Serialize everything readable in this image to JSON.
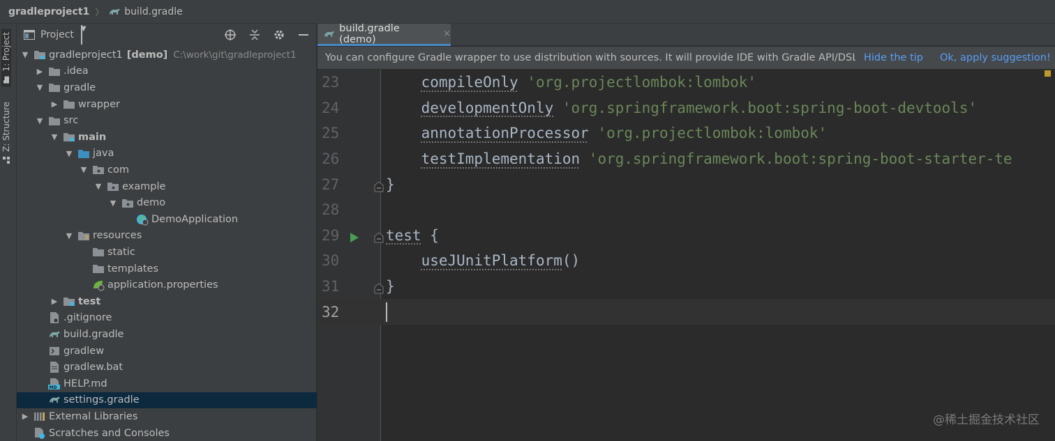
{
  "navbar": {
    "project": "gradleproject1",
    "separator": "〉",
    "file": "build.gradle"
  },
  "strip": {
    "project_tool": "1: Project",
    "structure_tool": "Z: Structure"
  },
  "panel": {
    "title": "Project",
    "tree": [
      {
        "label": "gradleproject1",
        "suffix": "[demo]",
        "path": "C:\\work\\git\\gradleproject1",
        "depth": 0,
        "arrow": "open",
        "icon": "module-folder-icon"
      },
      {
        "label": ".idea",
        "depth": 1,
        "arrow": "closed",
        "icon": "folder-icon"
      },
      {
        "label": "gradle",
        "depth": 1,
        "arrow": "open",
        "icon": "folder-icon"
      },
      {
        "label": "wrapper",
        "depth": 2,
        "arrow": "closed",
        "icon": "folder-icon"
      },
      {
        "label": "src",
        "depth": 1,
        "arrow": "open",
        "icon": "folder-icon"
      },
      {
        "label": "main",
        "depth": 2,
        "arrow": "open",
        "icon": "source-folder-icon",
        "bold": true
      },
      {
        "label": "java",
        "depth": 3,
        "arrow": "open",
        "icon": "java-folder-icon"
      },
      {
        "label": "com",
        "depth": 4,
        "arrow": "open",
        "icon": "package-icon"
      },
      {
        "label": "example",
        "depth": 5,
        "arrow": "open",
        "icon": "package-icon"
      },
      {
        "label": "demo",
        "depth": 6,
        "arrow": "open",
        "icon": "package-icon"
      },
      {
        "label": "DemoApplication",
        "depth": 7,
        "arrow": "none",
        "icon": "spring-class-icon"
      },
      {
        "label": "resources",
        "depth": 3,
        "arrow": "open",
        "icon": "resources-folder-icon"
      },
      {
        "label": "static",
        "depth": 4,
        "arrow": "none",
        "icon": "folder-icon"
      },
      {
        "label": "templates",
        "depth": 4,
        "arrow": "none",
        "icon": "folder-icon"
      },
      {
        "label": "application.properties",
        "depth": 4,
        "arrow": "none",
        "icon": "spring-properties-icon"
      },
      {
        "label": "test",
        "depth": 2,
        "arrow": "closed",
        "icon": "test-folder-icon",
        "bold": true
      },
      {
        "label": ".gitignore",
        "depth": 1,
        "arrow": "none",
        "icon": "gitignore-file-icon"
      },
      {
        "label": "build.gradle",
        "depth": 1,
        "arrow": "none",
        "icon": "gradle-icon"
      },
      {
        "label": "gradlew",
        "depth": 1,
        "arrow": "none",
        "icon": "shell-script-icon"
      },
      {
        "label": "gradlew.bat",
        "depth": 1,
        "arrow": "none",
        "icon": "text-file-icon"
      },
      {
        "label": "HELP.md",
        "depth": 1,
        "arrow": "none",
        "icon": "markdown-file-icon"
      },
      {
        "label": "settings.gradle",
        "depth": 1,
        "arrow": "none",
        "icon": "gradle-icon",
        "selected": true
      },
      {
        "label": "External Libraries",
        "depth": 0,
        "arrow": "closed",
        "icon": "libraries-icon"
      },
      {
        "label": "Scratches and Consoles",
        "depth": 0,
        "arrow": "none",
        "icon": "scratches-icon"
      }
    ]
  },
  "editor": {
    "tab_label": "build.gradle (demo)",
    "tab_close": "×",
    "tip_text": "You can configure Gradle wrapper to use distribution with sources. It will provide IDE with Gradle API/DSL ...",
    "tip_hide": "Hide the tip",
    "tip_apply": "Ok, apply suggestion!",
    "lines": [
      {
        "n": "23",
        "indent": "    ",
        "method": "compileOnly",
        "str": " 'org.projectlombok:lombok'"
      },
      {
        "n": "24",
        "indent": "    ",
        "method": "developmentOnly",
        "str": " 'org.springframework.boot:spring-boot-devtools'"
      },
      {
        "n": "25",
        "indent": "    ",
        "method": "annotationProcessor",
        "str": " 'org.projectlombok:lombok'"
      },
      {
        "n": "26",
        "indent": "    ",
        "method": "testImplementation",
        "str": " 'org.springframework.boot:spring-boot-starter-te"
      },
      {
        "n": "27",
        "plain": "}",
        "fold": true
      },
      {
        "n": "28",
        "plain": ""
      },
      {
        "n": "29",
        "method": "test",
        "rest": " {",
        "fold": true,
        "run": true
      },
      {
        "n": "30",
        "indent": "    ",
        "method": "useJUnitPlatform",
        "rest": "()"
      },
      {
        "n": "31",
        "plain": "}",
        "fold": true
      },
      {
        "n": "32",
        "plain": "",
        "current": true,
        "caret": true
      }
    ]
  },
  "watermark": "@稀土掘金技术社区",
  "colors": {
    "background": "#2b2b2b",
    "panel": "#3c3f41",
    "selection": "#0d293e",
    "link": "#589df6",
    "string": "#6a8759",
    "run_icon": "#499c54",
    "gradle_icon": "#7ea5a5"
  }
}
